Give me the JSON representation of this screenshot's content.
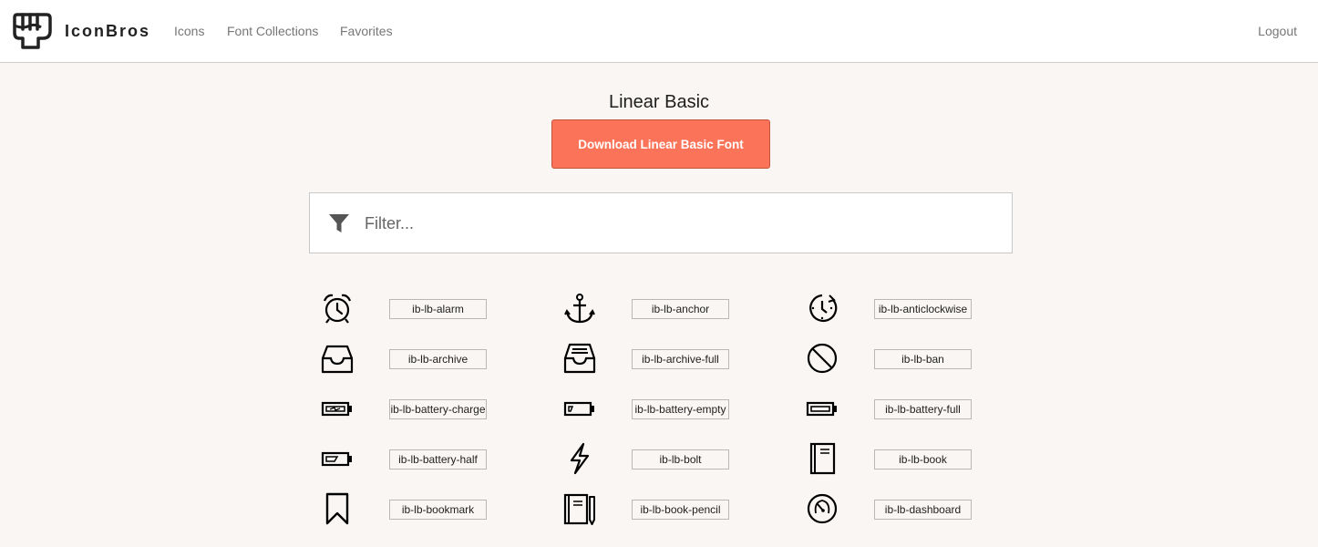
{
  "nav": {
    "brand": "IconBros",
    "links": [
      "Icons",
      "Font Collections",
      "Favorites"
    ],
    "logout": "Logout"
  },
  "collection": {
    "title": "Linear Basic",
    "download_label": "Download Linear Basic Font"
  },
  "filter": {
    "placeholder": "Filter..."
  },
  "icons": [
    {
      "icon": "alarm-icon",
      "label": "ib-lb-alarm"
    },
    {
      "icon": "anchor-icon",
      "label": "ib-lb-anchor"
    },
    {
      "icon": "anticlockwise-icon",
      "label": "ib-lb-anticlockwise"
    },
    {
      "icon": "archive-icon",
      "label": "ib-lb-archive"
    },
    {
      "icon": "archive-full-icon",
      "label": "ib-lb-archive-full"
    },
    {
      "icon": "ban-icon",
      "label": "ib-lb-ban"
    },
    {
      "icon": "battery-charge-icon",
      "label": "ib-lb-battery-charge"
    },
    {
      "icon": "battery-empty-icon",
      "label": "ib-lb-battery-empty"
    },
    {
      "icon": "battery-full-icon",
      "label": "ib-lb-battery-full"
    },
    {
      "icon": "battery-half-icon",
      "label": "ib-lb-battery-half"
    },
    {
      "icon": "bolt-icon",
      "label": "ib-lb-bolt"
    },
    {
      "icon": "book-icon",
      "label": "ib-lb-book"
    },
    {
      "icon": "bookmark-icon",
      "label": "ib-lb-bookmark"
    },
    {
      "icon": "book-pencil-icon",
      "label": "ib-lb-book-pencil"
    },
    {
      "icon": "dashboard-icon",
      "label": "ib-lb-dashboard"
    }
  ],
  "colors": {
    "accent": "#fb7358",
    "background": "#f9f6f3"
  }
}
